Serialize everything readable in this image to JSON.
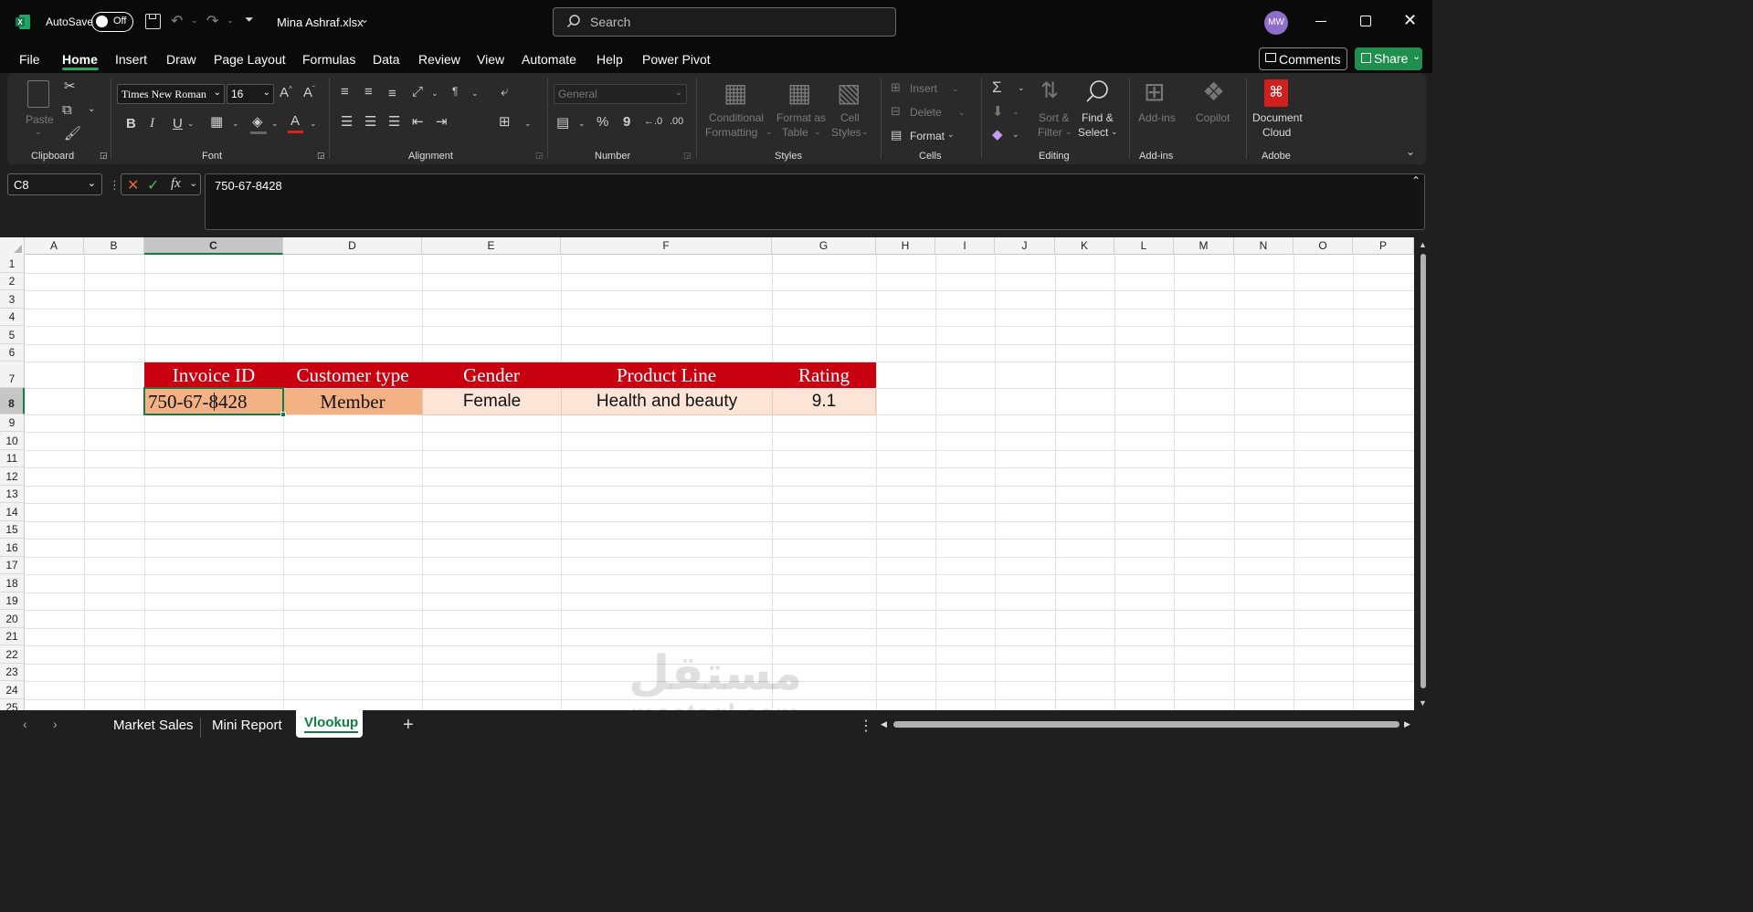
{
  "titlebar": {
    "app_icon": "excel-icon",
    "autosave_label": "AutoSave",
    "autosave_state": "Off",
    "file_name": "Mina Ashraf.xlsx",
    "search_placeholder": "Search",
    "avatar_initials": "MW"
  },
  "menu": {
    "tabs": [
      "File",
      "Home",
      "Insert",
      "Draw",
      "Page Layout",
      "Formulas",
      "Data",
      "Review",
      "View",
      "Automate",
      "Help",
      "Power Pivot"
    ],
    "active": "Home",
    "comments_label": "Comments",
    "share_label": "Share"
  },
  "ribbon": {
    "clipboard": {
      "label": "Clipboard",
      "paste": "Paste"
    },
    "font": {
      "label": "Font",
      "family": "Times New Roman",
      "size": "16"
    },
    "alignment": {
      "label": "Alignment"
    },
    "number": {
      "label": "Number",
      "format": "General"
    },
    "styles": {
      "label": "Styles",
      "conditional_1": "Conditional",
      "conditional_2": "Formatting",
      "format_as_1": "Format as",
      "format_as_2": "Table",
      "cell_styles_1": "Cell",
      "cell_styles_2": "Styles"
    },
    "cells": {
      "label": "Cells",
      "insert": "Insert",
      "delete": "Delete",
      "format": "Format"
    },
    "editing": {
      "label": "Editing",
      "sort_1": "Sort &",
      "sort_2": "Filter",
      "find_1": "Find &",
      "find_2": "Select"
    },
    "addins": {
      "label": "Add-ins",
      "addins_btn": "Add-ins",
      "copilot": "Copilot"
    },
    "adobe": {
      "label": "Adobe",
      "doc_1": "Document",
      "doc_2": "Cloud"
    },
    "accent": "#2fa35c"
  },
  "formula_bar": {
    "name_box": "C8",
    "fx": "fx",
    "value": "750-67-8428"
  },
  "grid": {
    "columns": [
      "A",
      "B",
      "C",
      "D",
      "E",
      "F",
      "G",
      "H",
      "I",
      "J",
      "K",
      "L",
      "M",
      "N",
      "O",
      "P"
    ],
    "rows": [
      "1",
      "2",
      "3",
      "4",
      "5",
      "6",
      "7",
      "8",
      "9",
      "10",
      "11",
      "12",
      "13",
      "14",
      "15",
      "16",
      "17",
      "18",
      "19",
      "20",
      "21",
      "22",
      "23",
      "24",
      "25"
    ],
    "selected_column": "C",
    "selected_row": "8",
    "table": {
      "headers": [
        "Invoice ID",
        "Customer type",
        "Gender",
        "Product Line",
        "Rating"
      ],
      "values": [
        "750-67-8428",
        "Member",
        "Female",
        "Health and beauty",
        "9.1"
      ]
    },
    "header_color": "#c8000f",
    "selected_fill": "#f4b183",
    "data_fill": "#fce4d6"
  },
  "sheets": {
    "tabs": [
      "Market Sales",
      "Mini Report",
      "Vlookup"
    ],
    "active": "Vlookup"
  },
  "watermark": {
    "arabic": "مستقل",
    "latin": "mostaql.com"
  }
}
